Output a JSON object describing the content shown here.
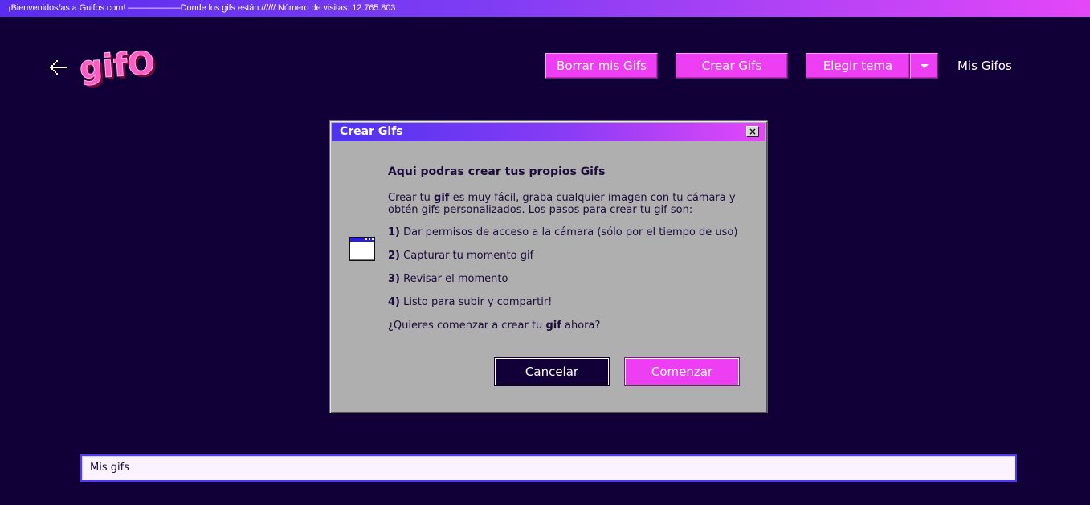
{
  "marquee": {
    "text": "¡Bienvenidos/as a Guifos.com! ——————Donde los gifs están.////// Número de visitas: 12.765.803"
  },
  "header": {
    "logo_text": "gifOS",
    "buttons": {
      "delete_label": "Borrar mis Gifs",
      "create_label": "Crear Gifs",
      "theme_label": "Elegir tema"
    },
    "my_gifos_label": "Mis Gifos"
  },
  "dialog": {
    "title": "Crear Gifs",
    "heading": "Aqui podras crear tus propios Gifs",
    "intro_pre": "Crear tu ",
    "intro_bold": "gif",
    "intro_post": " es muy fácil, graba cualquier imagen con tu cámara y obtén gifs personalizados. Los pasos para crear tu gif son:",
    "steps": [
      {
        "num": "1)",
        "text": " Dar permisos de acceso a la cámara (sólo por el tiempo de uso)"
      },
      {
        "num": "2)",
        "text": " Capturar tu momento gif"
      },
      {
        "num": "3)",
        "text": " Revisar el momento"
      },
      {
        "num": "4)",
        "text": " Listo para subir y compartir!"
      }
    ],
    "question_pre": "¿Quieres comenzar a crear tu ",
    "question_bold": "gif",
    "question_post": " ahora?",
    "cancel_label": "Cancelar",
    "start_label": "Comenzar",
    "close_symbol": "×"
  },
  "my_gifs_bar": {
    "label": "Mis gifs"
  },
  "colors": {
    "background": "#110038",
    "accent_pink": "#ee3ef3",
    "accent_blue": "#4e33f0",
    "dialog_gray": "#afafaf"
  },
  "icons": {
    "back": "arrow-left-icon",
    "dropdown": "chevron-down-icon",
    "window": "window-icon",
    "close": "close-icon"
  }
}
